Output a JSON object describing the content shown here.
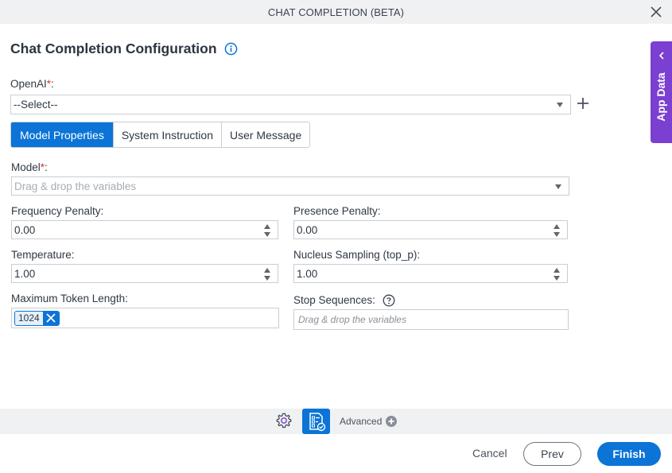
{
  "window": {
    "title": "CHAT COMPLETION (BETA)",
    "close_icon": "close-icon"
  },
  "heading": {
    "title": "Chat Completion Configuration",
    "info_icon": "info-icon"
  },
  "openai": {
    "label": "OpenAI",
    "required_mark": "*",
    "colon": ":",
    "value": "--Select--",
    "add_icon": "plus-icon"
  },
  "tabs": [
    {
      "label": "Model Properties",
      "active": true
    },
    {
      "label": "System Instruction",
      "active": false
    },
    {
      "label": "User Message",
      "active": false
    }
  ],
  "model": {
    "label": "Model",
    "required_mark": "*",
    "colon": ":",
    "placeholder": "Drag & drop the variables"
  },
  "fields": {
    "frequency_penalty": {
      "label": "Frequency Penalty:",
      "value": "0.00"
    },
    "presence_penalty": {
      "label": "Presence Penalty:",
      "value": "0.00"
    },
    "temperature": {
      "label": "Temperature:",
      "value": "1.00"
    },
    "top_p": {
      "label": "Nucleus Sampling (top_p):",
      "value": "1.00"
    },
    "max_tokens": {
      "label": "Maximum Token Length:",
      "chip_value": "1024"
    },
    "stop_sequences": {
      "label": "Stop Sequences:",
      "placeholder": "Drag & drop the variables",
      "help_icon": "question-icon"
    }
  },
  "app_data": {
    "label": "App Data",
    "icon": "chevron-left-icon"
  },
  "toolbar": {
    "settings_icon": "gear-icon",
    "form_icon": "form-checklist-icon",
    "advanced_label": "Advanced",
    "advanced_icon": "plus-circle-icon"
  },
  "footer": {
    "cancel_label": "Cancel",
    "prev_label": "Prev",
    "finish_label": "Finish"
  },
  "colors": {
    "primary": "#0b74d6",
    "app_data": "#7b3fd1",
    "required": "#d0342c"
  }
}
